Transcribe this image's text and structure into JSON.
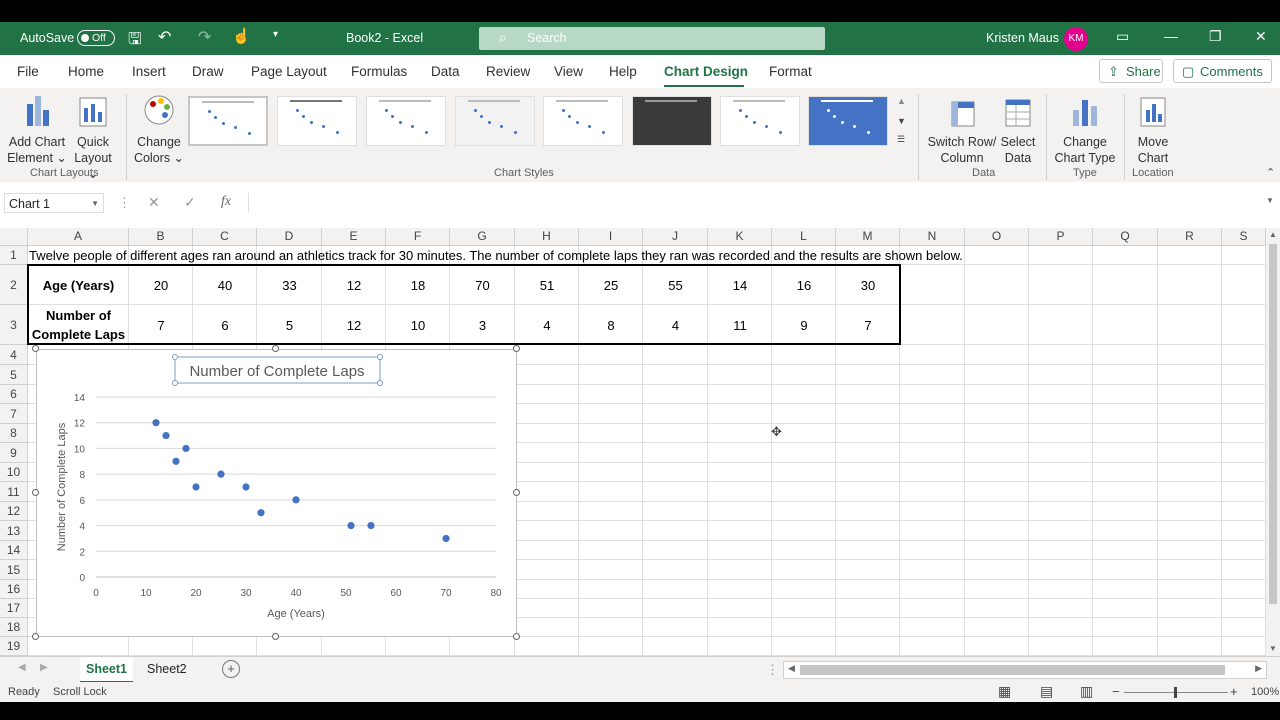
{
  "titlebar": {
    "autosave_label": "AutoSave",
    "autosave_state": "Off",
    "doc_title": "Book2  -  Excel",
    "search_placeholder": "Search",
    "user_name": "Kristen Maus",
    "user_initials": "KM"
  },
  "ribbon_tabs": [
    "File",
    "Home",
    "Insert",
    "Draw",
    "Page Layout",
    "Formulas",
    "Data",
    "Review",
    "View",
    "Help",
    "Chart Design",
    "Format"
  ],
  "active_tab": "Chart Design",
  "share_label": "Share",
  "comments_label": "Comments",
  "ribbon": {
    "add_chart_element": [
      "Add Chart",
      "Element ⌄"
    ],
    "quick_layout": [
      "Quick",
      "Layout ⌄"
    ],
    "change_colors": [
      "Change",
      "Colors ⌄"
    ],
    "switch_row_column": [
      "Switch Row/",
      "Column"
    ],
    "select_data": [
      "Select",
      "Data"
    ],
    "change_chart_type": [
      "Change",
      "Chart Type"
    ],
    "move_chart": [
      "Move",
      "Chart"
    ],
    "groups": {
      "chart_layouts": "Chart Layouts",
      "chart_styles": "Chart Styles",
      "data": "Data",
      "type": "Type",
      "location": "Location"
    }
  },
  "formula_bar": {
    "name_box": "Chart 1",
    "fx": "fx",
    "formula": ""
  },
  "columns": [
    "A",
    "B",
    "C",
    "D",
    "E",
    "F",
    "G",
    "H",
    "I",
    "J",
    "K",
    "L",
    "M",
    "N",
    "O",
    "P",
    "Q",
    "R",
    "S"
  ],
  "rows": [
    "1",
    "2",
    "3",
    "4",
    "5",
    "6",
    "7",
    "8",
    "9",
    "10",
    "11",
    "12",
    "13",
    "14",
    "15",
    "16",
    "17",
    "18",
    "19"
  ],
  "sheet": {
    "a1_text": "Twelve people of different ages ran around an athletics track for 30 minutes. The number of complete laps they ran was recorded and the results are shown below.",
    "row2_label": "Age (Years)",
    "row3_label": "Number of Complete Laps",
    "ages": [
      "20",
      "40",
      "33",
      "12",
      "18",
      "70",
      "51",
      "25",
      "55",
      "14",
      "16",
      "30"
    ],
    "laps": [
      "7",
      "6",
      "5",
      "12",
      "10",
      "3",
      "4",
      "8",
      "4",
      "11",
      "9",
      "7"
    ]
  },
  "chart_data": {
    "type": "scatter",
    "title": "Number of Complete Laps",
    "xlabel": "Age (Years)",
    "ylabel": "Number of Complete Laps",
    "xlim": [
      0,
      80
    ],
    "ylim": [
      0,
      14
    ],
    "xticks": [
      "0",
      "10",
      "20",
      "30",
      "40",
      "50",
      "60",
      "70",
      "80"
    ],
    "yticks": [
      "0",
      "2",
      "4",
      "6",
      "8",
      "10",
      "12",
      "14"
    ],
    "grid": "horizontal",
    "x": [
      20,
      40,
      33,
      12,
      18,
      70,
      51,
      25,
      55,
      14,
      16,
      30
    ],
    "y": [
      7,
      6,
      5,
      12,
      10,
      3,
      4,
      8,
      4,
      11,
      9,
      7
    ],
    "color": "#4472c4"
  },
  "sheet_tabs": [
    "Sheet1",
    "Sheet2"
  ],
  "active_sheet": "Sheet1",
  "status": {
    "ready": "Ready",
    "scroll_lock": "Scroll Lock",
    "zoom": "100%"
  },
  "colors": {
    "excel_green": "#217346",
    "marker_blue": "#4472c4"
  }
}
